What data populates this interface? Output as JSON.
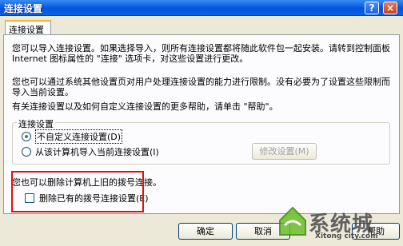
{
  "window": {
    "title": "连接设置",
    "help_button": "?",
    "close_button": "×"
  },
  "tabs": [
    "连接设置"
  ],
  "panel": {
    "paragraph1": "您可以导入连接设置。如果选择导入，则所有连接设置都将随此软件包一起安装。请转到控制面板 Internet 图标属性的 \"连接\" 选项卡，对这些设置进行更改。",
    "paragraph2": "您也可以通过系统其他设置页对用户处理连接设置的能力进行限制。没有必要为了设置这些限制而导入当前设置。",
    "paragraph3": "有关连接设置以及如何自定义连接设置的更多帮助，请单击 \"帮助\"。",
    "group": {
      "label": "连接设置",
      "options": [
        {
          "label": "不自定义连接设置(D)",
          "selected": true
        },
        {
          "label": "从该计算机导入当前连接设置(I)",
          "selected": false
        }
      ],
      "modify_button": "修改设置(M)"
    },
    "delete_text": "您也可以删除计算机上旧的拨号连接。",
    "delete_checkbox": {
      "label": "删除已有的拨号连接设置(E)",
      "checked": false
    }
  },
  "footer": {
    "ok": "确定",
    "cancel": "取消",
    "help": "帮助"
  },
  "watermark": {
    "text": "系统城",
    "sub": "Xitong city.com"
  },
  "colors": {
    "titlebar": "#0a5ee3",
    "highlight": "#e01010",
    "radio_selected": "#21a121"
  }
}
